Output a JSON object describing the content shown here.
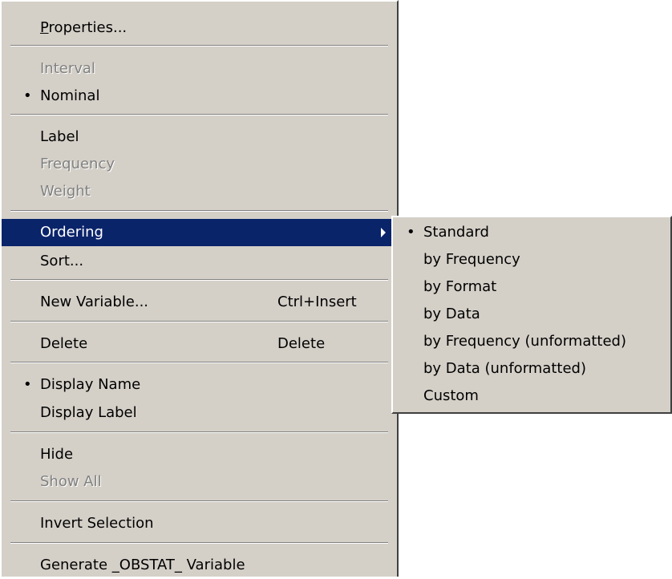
{
  "context_menu": {
    "properties": "Properties...",
    "interval": "Interval",
    "nominal": "Nominal",
    "label": "Label",
    "frequency": "Frequency",
    "weight": "Weight",
    "ordering": "Ordering",
    "sort": "Sort...",
    "new_variable": "New Variable...",
    "new_variable_shortcut": "Ctrl+Insert",
    "delete": "Delete",
    "delete_shortcut": "Delete",
    "display_name": "Display Name",
    "display_label": "Display Label",
    "hide": "Hide",
    "show_all": "Show All",
    "invert_selection": "Invert Selection",
    "generate_obstat": "Generate _OBSTAT_ Variable",
    "bullet": "•"
  },
  "ordering_submenu": {
    "standard": "Standard",
    "by_frequency": "by Frequency",
    "by_format": "by Format",
    "by_data": "by Data",
    "by_frequency_unformatted": "by Frequency (unformatted)",
    "by_data_unformatted": "by Data (unformatted)",
    "custom": "Custom",
    "bullet": "•"
  },
  "colors": {
    "menu_background": "#d4d0c8",
    "highlight": "#0a246a",
    "disabled_text": "#808080"
  }
}
